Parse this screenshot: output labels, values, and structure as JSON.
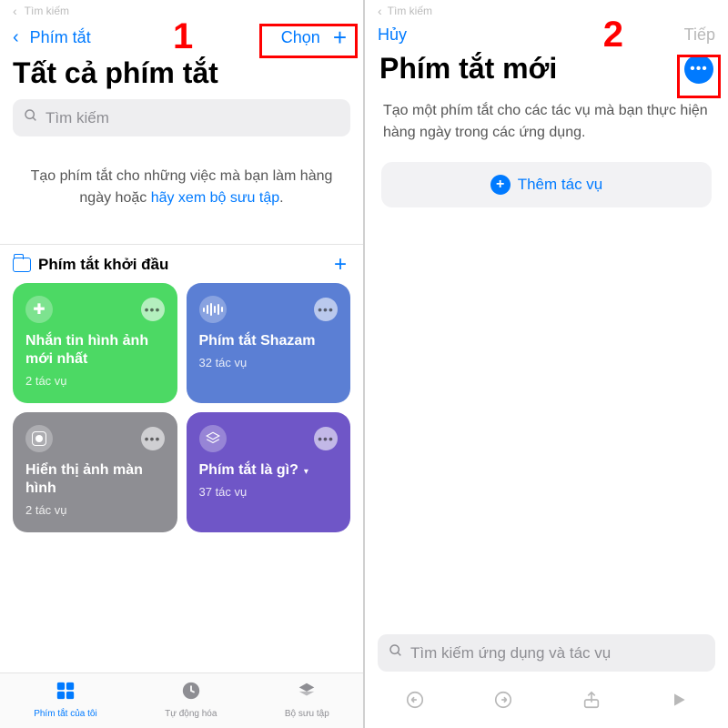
{
  "screen1": {
    "faint_back": "Tìm kiếm",
    "nav_back": "Phím tắt",
    "nav_select": "Chọn",
    "title": "Tất cả phím tắt",
    "search_placeholder": "Tìm kiếm",
    "info_a": "Tạo phím tắt cho những việc mà bạn làm hàng ngày hoặc ",
    "info_link": "hãy xem bộ sưu tập",
    "info_dot": ".",
    "section_title": "Phím tắt khởi đầu",
    "cards": [
      {
        "title": "Nhắn tin hình ảnh mới nhất",
        "sub": "2 tác vụ"
      },
      {
        "title": "Phím tắt Shazam",
        "sub": "32 tác vụ"
      },
      {
        "title": "Hiển thị ảnh màn hình",
        "sub": "2 tác vụ"
      },
      {
        "title": "Phím tắt là gì?",
        "sub": "37 tác vụ"
      }
    ],
    "tabs": {
      "t1": "Phím tắt của tôi",
      "t2": "Tự động hóa",
      "t3": "Bộ sưu tập"
    }
  },
  "screen2": {
    "faint_back": "Tìm kiếm",
    "nav_cancel": "Hủy",
    "nav_next": "Tiếp",
    "title": "Phím tắt mới",
    "desc": "Tạo một phím tắt cho các tác vụ mà bạn thực hiện hàng ngày trong các ứng dụng.",
    "add_action": "Thêm tác vụ",
    "search_placeholder": "Tìm kiếm ứng dụng và tác vụ"
  },
  "annot": {
    "n1": "1",
    "n2": "2"
  }
}
